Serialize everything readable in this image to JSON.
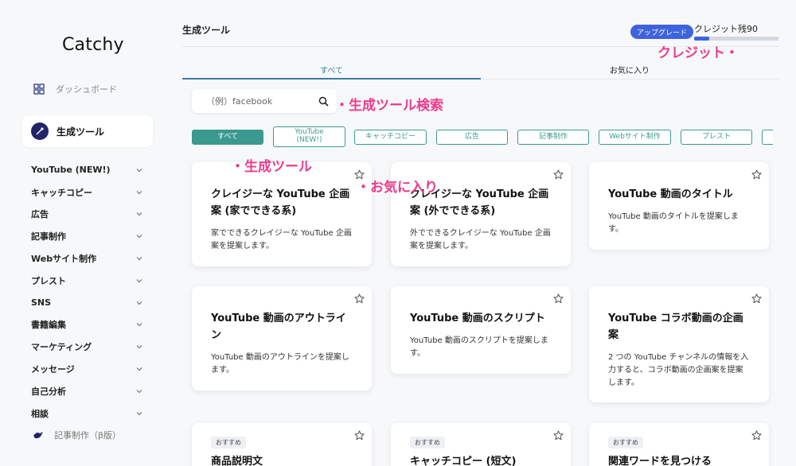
{
  "sidebar": {
    "logo": "Catchy",
    "dashboard_label": "ダッシュボード",
    "active_label": "生成ツール",
    "categories": [
      "YouTube (NEW!)",
      "キャッチコピー",
      "広告",
      "記事制作",
      "Webサイト制作",
      "プレスト",
      "SNS",
      "書籍編集",
      "マーケティング",
      "メッセージ",
      "自己分析",
      "相談"
    ],
    "beta_label": "記事制作（β版）"
  },
  "header": {
    "title": "生成ツール",
    "upgrade_label": "アップグレード",
    "credit_label": "クレジット残90",
    "credit_progress": 0.18
  },
  "tabs": {
    "all": "すべて",
    "favorites": "お気に入り"
  },
  "search": {
    "placeholder": "（例）facebook"
  },
  "filters": {
    "all": "すべて",
    "youtube_line1": "YouTube",
    "youtube_line2": "(NEW!)",
    "catchcopy": "キャッチコピー",
    "ad": "広告",
    "article": "記事制作",
    "website": "Webサイト制作",
    "press": "プレスト"
  },
  "cards": [
    {
      "title": "クレイジーな YouTube 企画案 (家でできる系)",
      "desc": "家でできるクレイジーな YouTube 企画案を提案します。"
    },
    {
      "title": "クレイジーな YouTube 企画案 (外でできる系)",
      "desc": "外でできるクレイジーな YouTube 企画案を提案します。"
    },
    {
      "title": "YouTube 動画のタイトル",
      "desc": "YouTube 動画のタイトルを提案します。"
    },
    {
      "title": "YouTube 動画のアウトライン",
      "desc": "YouTube 動画のアウトラインを提案します。"
    },
    {
      "title": "YouTube 動画のスクリプト",
      "desc": "YouTube 動画のスクリプトを提案します。"
    },
    {
      "title": "YouTube コラボ動画の企画案",
      "desc": "2 つの YouTube チャンネルの情報を入力すると、コラボ動画の企画案を提案します。"
    },
    {
      "badge": "おすすめ",
      "title": "商品説明文"
    },
    {
      "badge": "おすすめ",
      "title": "キャッチコピー (短文)"
    },
    {
      "badge": "おすすめ",
      "title": "関連ワードを見つける"
    }
  ],
  "annotations": {
    "credit": "クレジット・",
    "search": "・生成ツール検索",
    "tools": "・生成ツール",
    "favorites": "・お気に入り"
  },
  "colors": {
    "accent_teal": "#3a9a8f",
    "tab_blue": "#3a7ca5",
    "upgrade_blue": "#3e63dd",
    "annotation_pink": "#ee3a8c",
    "nav_icon_navy": "#22236b"
  }
}
